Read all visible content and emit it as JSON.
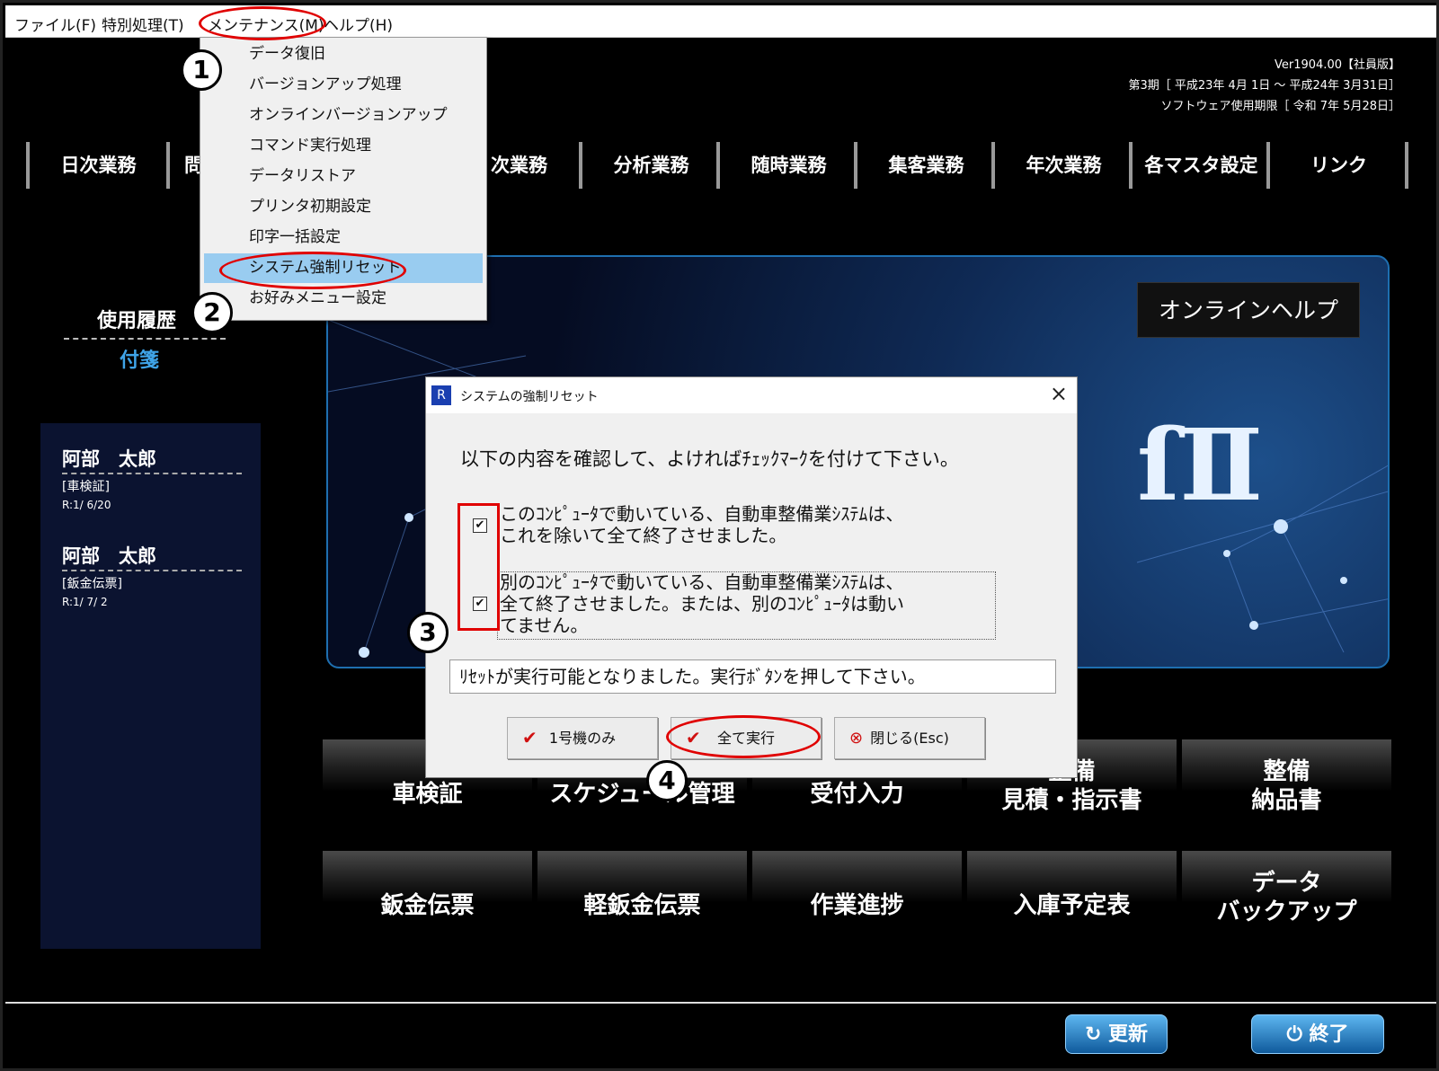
{
  "menubar": {
    "items": [
      {
        "label": "ファイル(F)"
      },
      {
        "label": "特別処理(T)"
      },
      {
        "label": "メンテナンス(M)"
      },
      {
        "label": "ヘルプ(H)"
      }
    ]
  },
  "maintenance_menu": {
    "items": [
      {
        "label": "データ復旧"
      },
      {
        "label": "バージョンアップ処理"
      },
      {
        "label": "オンラインバージョンアップ"
      },
      {
        "label": "コマンド実行処理"
      },
      {
        "label": "データリストア"
      },
      {
        "label": "プリンタ初期設定"
      },
      {
        "label": "印字一括設定"
      },
      {
        "label": "システム強制リセット"
      },
      {
        "label": "お好みメニュー設定"
      }
    ],
    "highlighted_index": 7
  },
  "version_info": {
    "line1": "Ver1904.00【社員版】",
    "line2": "第3期［ 平成23年 4月 1日 ～ 平成24年 3月31日］",
    "line3": "ソフトウェア使用期限［ 令和 7年 5月28日］"
  },
  "nav": {
    "items": [
      {
        "label": "日次業務"
      },
      {
        "label": "問"
      },
      {
        "label": "次業務"
      },
      {
        "label": "分析業務"
      },
      {
        "label": "随時業務"
      },
      {
        "label": "集客業務"
      },
      {
        "label": "年次業務"
      },
      {
        "label": "各マスタ設定"
      },
      {
        "label": "リンク"
      }
    ]
  },
  "left_panel": {
    "tab_history": "使用履歴",
    "tab_fusen": "付箋",
    "history": [
      {
        "name": "阿部　太郎",
        "type": "[車検証]",
        "date": "R:1/ 6/20"
      },
      {
        "name": "阿部　太郎",
        "type": "[鈑金伝票]",
        "date": "R:1/ 7/ 2"
      }
    ]
  },
  "banner": {
    "help_button": "オンラインヘルプ",
    "logo_fragment": "ſⅡ"
  },
  "tiles": {
    "row1": [
      {
        "line1": "車検証",
        "line2": ""
      },
      {
        "line1": "スケジュール管理",
        "line2": ""
      },
      {
        "line1": "受付入力",
        "line2": ""
      },
      {
        "line1": "整備",
        "line2": "見積・指示書"
      },
      {
        "line1": "整備",
        "line2": "納品書"
      }
    ],
    "row2": [
      {
        "line1": "鈑金伝票",
        "line2": ""
      },
      {
        "line1": "軽鈑金伝票",
        "line2": ""
      },
      {
        "line1": "作業進捗",
        "line2": ""
      },
      {
        "line1": "入庫予定表",
        "line2": ""
      },
      {
        "line1": "データ",
        "line2": "バックアップ"
      }
    ]
  },
  "bottom": {
    "refresh": "更新",
    "exit": "終了"
  },
  "dialog": {
    "icon_letter": "R",
    "title": "システムの強制リセット",
    "close": "×",
    "message": "以下の内容を確認して、よければﾁｪｯｸﾏｰｸを付けて下さい。",
    "check1": {
      "checked": true,
      "mark": "✔",
      "line1": "このｺﾝﾋﾟｭｰﾀで動いている、自動車整備業ｼｽﾃﾑは、",
      "line2": "これを除いて全て終了させました。"
    },
    "check2": {
      "checked": true,
      "mark": "✔",
      "line1": "別のｺﾝﾋﾟｭｰﾀで動いている、自動車整備業ｼｽﾃﾑは、",
      "line2": "全て終了させました。または、別のｺﾝﾋﾟｭｰﾀは動い",
      "line3": "てません。"
    },
    "status": "ﾘｾｯﾄが実行可能となりました。実行ﾎﾞﾀﾝを押して下さい。",
    "buttons": {
      "only_one": "1号機のみ",
      "run_all": "全て実行",
      "close": "閉じる(Esc)"
    }
  },
  "annotations": {
    "n1": "1",
    "n2": "2",
    "n3": "3",
    "n4": "4"
  },
  "colors": {
    "background": "#000000",
    "accent_blue": "#3fa4e8",
    "highlight": "#99ccf0",
    "annotation_red": "#e00000"
  }
}
